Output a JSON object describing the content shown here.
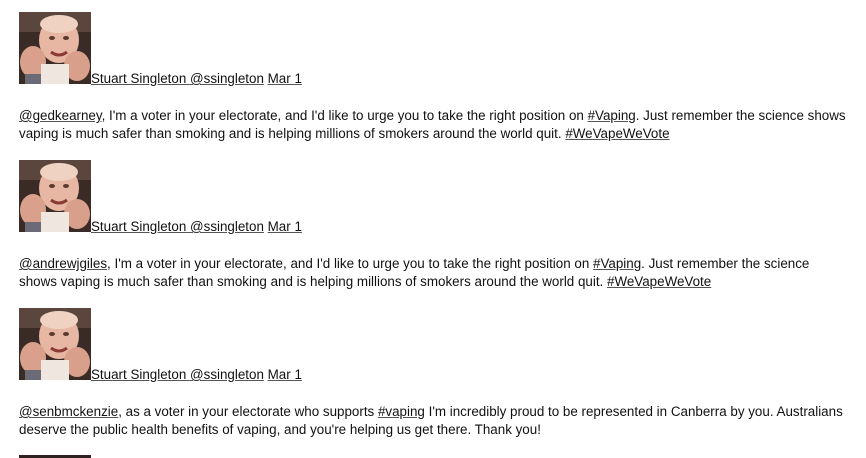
{
  "tweets": [
    {
      "author_name": "Stuart Singleton",
      "author_handle": "@ssingleton",
      "date": "Mar 1",
      "mention": "@gedkearney",
      "text_before_hashtag": ", I'm a voter in your electorate, and I'd like to urge you to take the right position on ",
      "hashtag1": "#Vaping",
      "text_after_hashtag": ". Just remember the science shows vaping is much safer than smoking and is helping millions of smokers around the world quit. ",
      "hashtag2": "#WeVapeWeVote"
    },
    {
      "author_name": "Stuart Singleton",
      "author_handle": "@ssingleton",
      "date": "Mar 1",
      "mention": "@andrewjgiles",
      "text_before_hashtag": ", I'm a voter in your electorate, and I'd like to urge you to take the right position on ",
      "hashtag1": "#Vaping",
      "text_after_hashtag": ". Just remember the science shows vaping is much safer than smoking and is helping millions of smokers around the world quit. ",
      "hashtag2": "#WeVapeWeVote"
    },
    {
      "author_name": "Stuart Singleton",
      "author_handle": "@ssingleton",
      "date": "Mar 1",
      "mention": "@senbmckenzie",
      "text_before_hashtag": ", as a voter in your electorate who supports ",
      "hashtag1": "#vaping",
      "text_after_hashtag": " I'm incredibly proud to be represented in Canberra by you. Australians deserve the public health benefits of vaping, and you're helping us get there. Thank you!",
      "hashtag2": ""
    }
  ]
}
